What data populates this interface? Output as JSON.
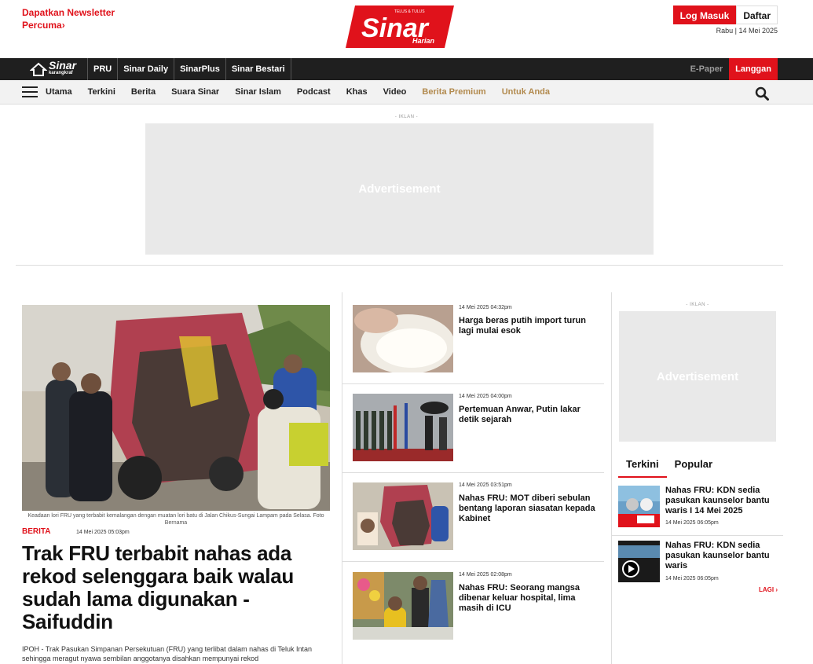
{
  "header": {
    "newsletter": "Dapatkan Newsletter Percuma›",
    "logo_text": "Sinar",
    "logo_sub": "Harian",
    "logo_tagline": "TELUS & TULUS",
    "login": "Log Masuk",
    "register": "Daftar",
    "date": "Rabu | 14 Mei 2025"
  },
  "darkbar": {
    "logo_text": "Sinar",
    "logo_sub": "karangkraf",
    "items": [
      "PRU",
      "Sinar Daily",
      "SinarPlus",
      "Sinar Bestari"
    ],
    "epaper": "E-Paper",
    "subscribe": "Langgan"
  },
  "nav": {
    "items": [
      "Utama",
      "Terkini",
      "Berita",
      "Suara Sinar",
      "Sinar Islam",
      "Podcast",
      "Khas",
      "Video",
      "Berita Premium",
      "Untuk Anda"
    ]
  },
  "ads": {
    "label": "- IKLAN -",
    "text": "Advertisement"
  },
  "main_story": {
    "caption": "Keadaan lori FRU yang terbabit kemalangan dengan muatan lori batu di Jalan Chikus-Sungai Lampam pada Selasa. Foto Bernama",
    "category": "BERITA",
    "time": "14 Mei 2025 05:03pm",
    "headline": "Trak FRU terbabit nahas ada rekod selenggara baik walau sudah lama digunakan - Saifuddin",
    "excerpt": "IPOH - Trak Pasukan Simpanan Persekutuan (FRU) yang terlibat dalam nahas di Teluk Intan sehingga meragut nyawa sembilan anggotanya disahkan mempunyai rekod"
  },
  "stories": [
    {
      "time": "14 Mei 2025 04:32pm",
      "title": "Harga beras putih import turun lagi mulai esok"
    },
    {
      "time": "14 Mei 2025 04:00pm",
      "title": "Pertemuan Anwar, Putin lakar detik sejarah"
    },
    {
      "time": "14 Mei 2025 03:51pm",
      "title": "Nahas FRU: MOT diberi sebulan bentang laporan siasatan kepada Kabinet"
    },
    {
      "time": "14 Mei 2025 02:08pm",
      "title": "Nahas FRU: Seorang mangsa dibenar keluar hospital, lima masih di ICU"
    }
  ],
  "sidebar": {
    "tabs": [
      "Terkini",
      "Popular"
    ],
    "items": [
      {
        "title": "Nahas FRU: KDN sedia pasukan kaunselor bantu waris I 14 Mei 2025",
        "time": "14 Mei 2025 06:05pm"
      },
      {
        "title": "Nahas FRU: KDN sedia pasukan kaunselor bantu waris",
        "time": "14 Mei 2025 06:05pm"
      }
    ],
    "more": "LAGI ›"
  },
  "colors": {
    "brand_red": "#e0121b",
    "dark": "#1f1f1f",
    "gold": "#b28a4e"
  }
}
